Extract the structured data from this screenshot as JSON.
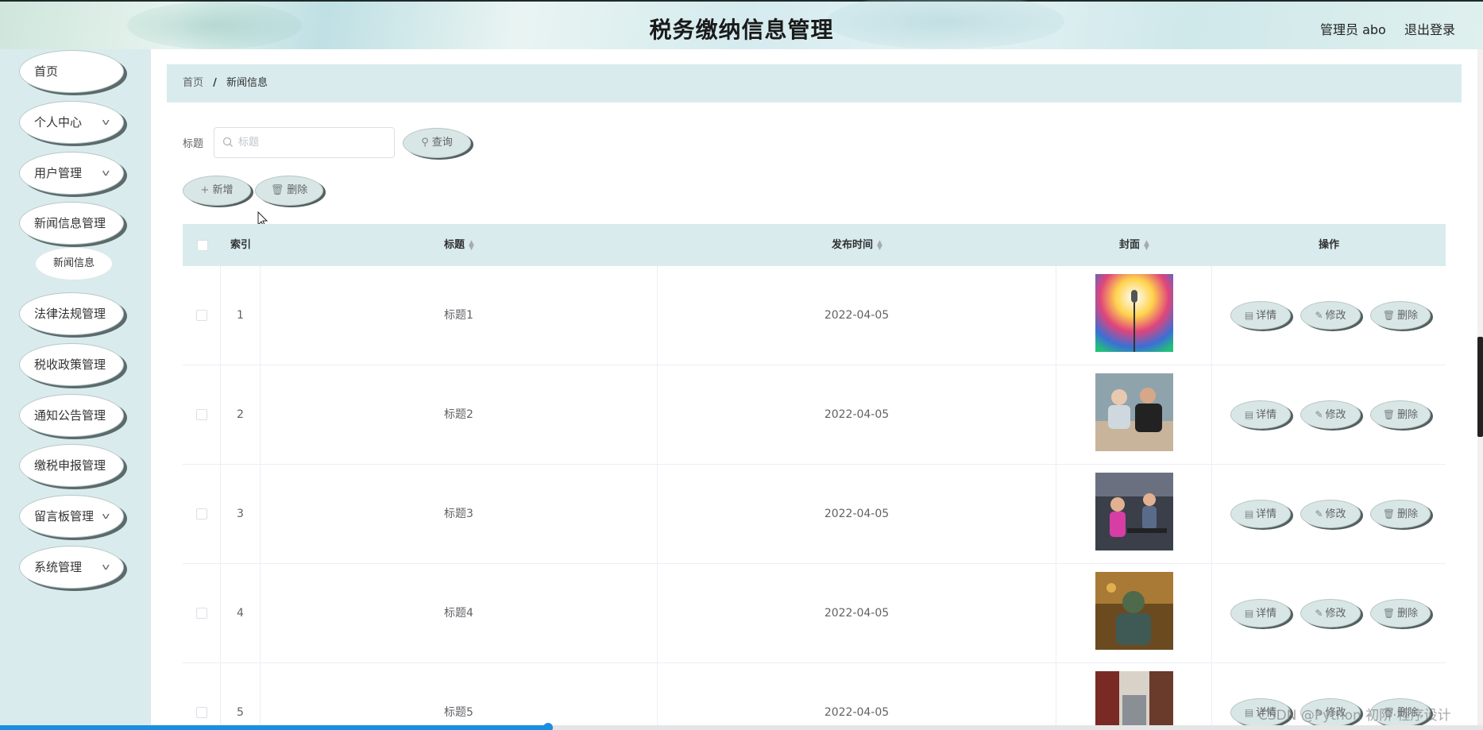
{
  "header": {
    "title": "税务缴纳信息管理",
    "admin": "管理员 abo",
    "logout": "退出登录"
  },
  "sidebar": {
    "items": [
      {
        "label": "首页",
        "has_arrow": false
      },
      {
        "label": "个人中心",
        "has_arrow": true
      },
      {
        "label": "用户管理",
        "has_arrow": true
      },
      {
        "label": "新闻信息管理",
        "has_arrow": false
      },
      {
        "label": "法律法规管理",
        "has_arrow": false
      },
      {
        "label": "税收政策管理",
        "has_arrow": false
      },
      {
        "label": "通知公告管理",
        "has_arrow": false
      },
      {
        "label": "缴税申报管理",
        "has_arrow": false
      },
      {
        "label": "留言板管理",
        "has_arrow": true
      },
      {
        "label": "系统管理",
        "has_arrow": true
      }
    ],
    "submenu": {
      "label": "新闻信息"
    }
  },
  "breadcrumb": {
    "home": "首页",
    "separator": "/",
    "current": "新闻信息"
  },
  "search": {
    "label": "标题",
    "placeholder": "标题",
    "value": "",
    "button": "查询"
  },
  "actions": {
    "add": "新增",
    "delete": "删除"
  },
  "table": {
    "columns": [
      "索引",
      "标题",
      "发布时间",
      "封面",
      "操作"
    ],
    "rows": [
      {
        "index": "1",
        "title": "标题1",
        "date": "2022-04-05",
        "cover": "microphone-stage-lights"
      },
      {
        "index": "2",
        "title": "标题2",
        "date": "2022-04-05",
        "cover": "two-people-at-table"
      },
      {
        "index": "3",
        "title": "标题3",
        "date": "2022-04-05",
        "cover": "gym-treadmills"
      },
      {
        "index": "4",
        "title": "标题4",
        "date": "2022-04-05",
        "cover": "armored-figure"
      },
      {
        "index": "5",
        "title": "标题5",
        "date": "2022-04-05",
        "cover": "library-shelves"
      }
    ],
    "row_actions": {
      "detail": "详情",
      "edit": "修改",
      "delete": "删除"
    }
  },
  "watermark": "CSDN @Python 初阶·程序设计",
  "colors": {
    "sidebar_bg": "#d9ebed",
    "header_bar": "#d9ebed",
    "button_bg": "#d9e6e6",
    "button_shadow": "#536060",
    "progress": "#1a8fe0"
  },
  "progress": 0.37
}
